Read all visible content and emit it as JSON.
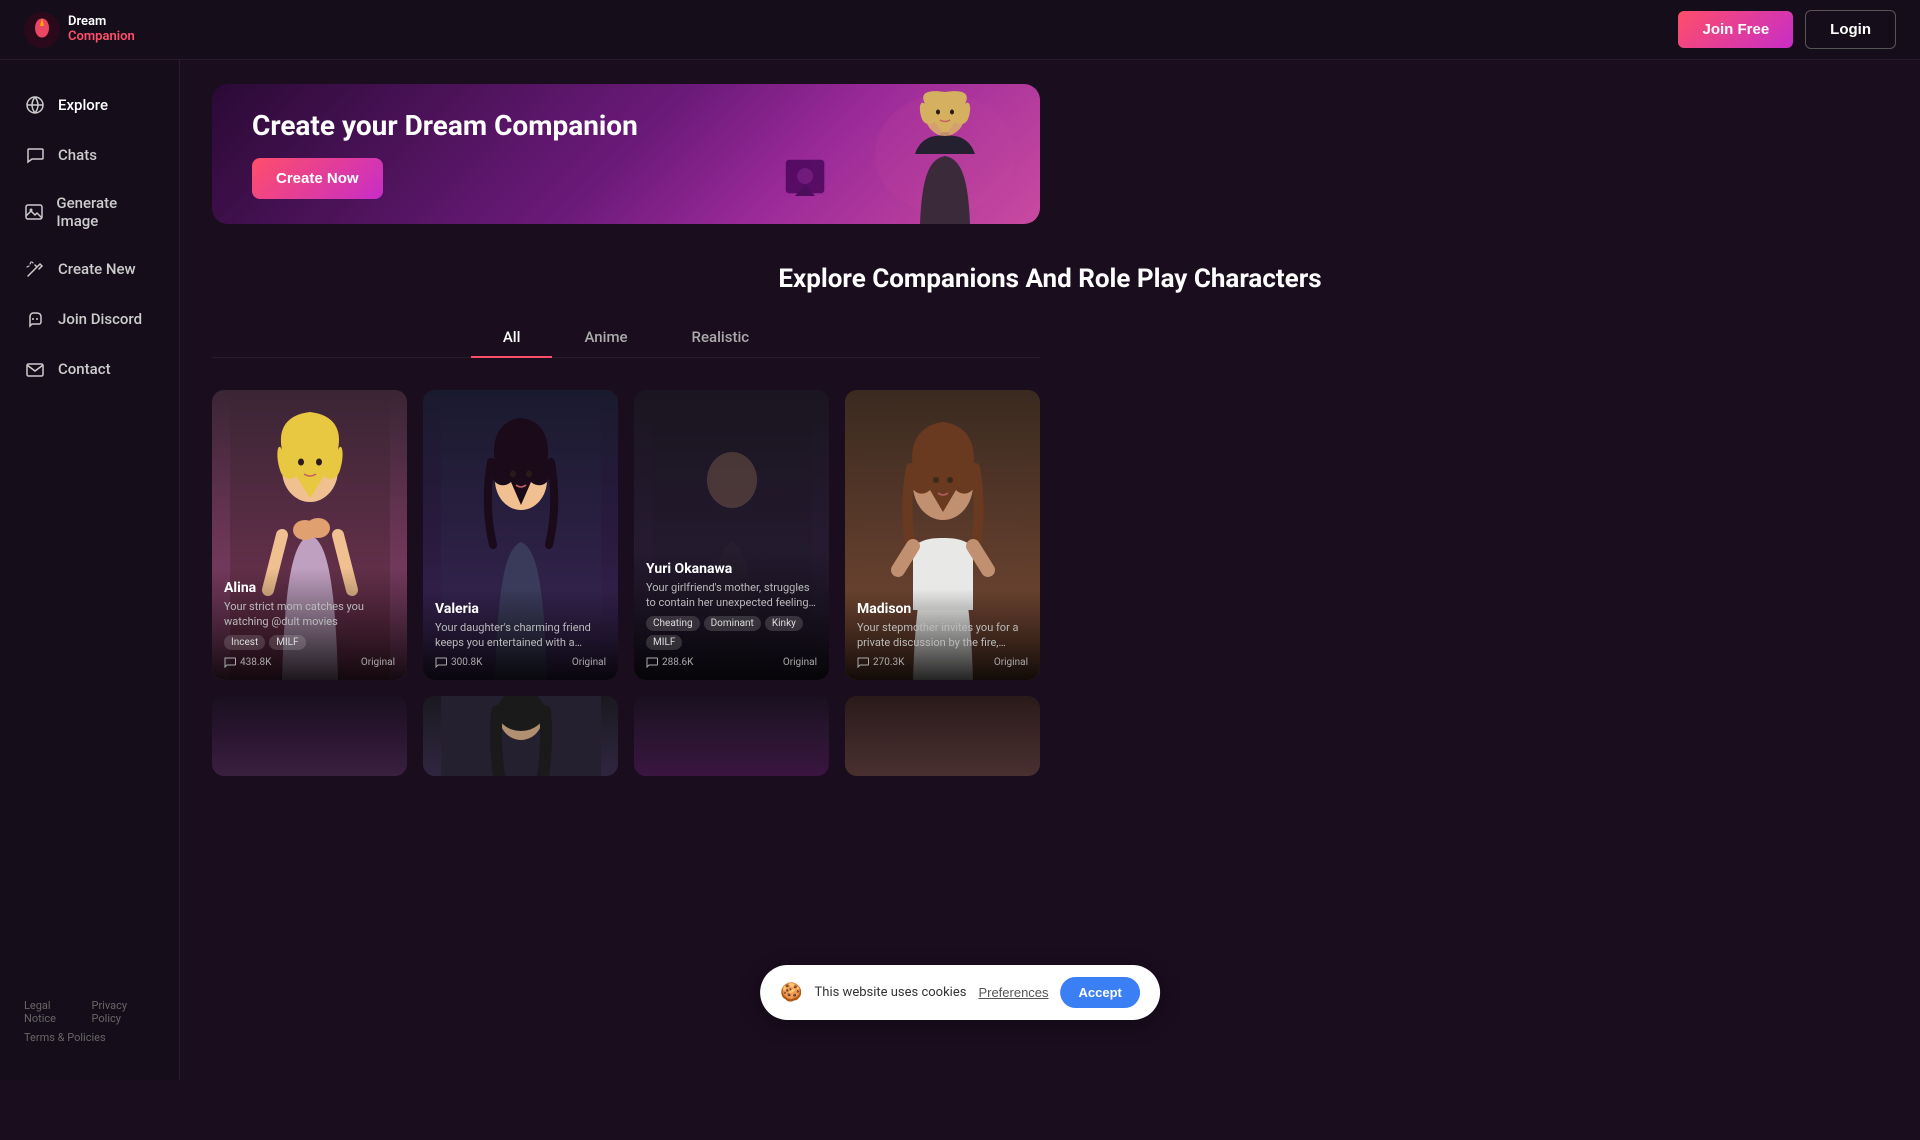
{
  "header": {
    "logo_dream": "Dream",
    "logo_companion": "Companion",
    "btn_join_free": "Join Free",
    "btn_login": "Login"
  },
  "sidebar": {
    "items": [
      {
        "id": "explore",
        "label": "Explore",
        "icon": "globe"
      },
      {
        "id": "chats",
        "label": "Chats",
        "icon": "chat"
      },
      {
        "id": "generate-image",
        "label": "Generate Image",
        "icon": "image"
      },
      {
        "id": "create-new",
        "label": "Create New",
        "icon": "wand"
      },
      {
        "id": "join-discord",
        "label": "Join Discord",
        "icon": "discord"
      },
      {
        "id": "contact",
        "label": "Contact",
        "icon": "mail"
      }
    ],
    "footer": {
      "links": [
        {
          "label": "Legal Notice"
        },
        {
          "label": "Privacy Policy"
        }
      ],
      "bottom": "Terms & Policies"
    }
  },
  "hero": {
    "title": "Create your Dream Companion",
    "btn_create": "Create Now"
  },
  "explore": {
    "section_title": "Explore Companions And Role Play Characters",
    "tabs": [
      {
        "id": "all",
        "label": "All",
        "active": true
      },
      {
        "id": "anime",
        "label": "Anime",
        "active": false
      },
      {
        "id": "realistic",
        "label": "Realistic",
        "active": false
      }
    ],
    "cards": [
      {
        "id": "alina",
        "name": "Alina",
        "description": "Your strict mom catches you watching @dult movies",
        "tags": [
          "Incest",
          "MILF"
        ],
        "count": "438.8K",
        "badge": "Original",
        "style": "alina"
      },
      {
        "id": "valeria",
        "name": "Valeria",
        "description": "Your daughter's charming friend keeps you entertained with a playful...",
        "tags": [],
        "count": "300.8K",
        "badge": "Original",
        "style": "valeria"
      },
      {
        "id": "yuri-okanawa",
        "name": "Yuri Okanawa",
        "description": "Your girlfriend's mother, struggles to contain her unexpected feelings of...",
        "tags": [
          "Cheating",
          "Dominant",
          "Kinky",
          "MILF"
        ],
        "count": "288.6K",
        "badge": "Original",
        "style": "yuri"
      },
      {
        "id": "madison",
        "name": "Madison",
        "description": "Your stepmother invites you for a private discussion by the fire, hinting a...",
        "tags": [],
        "count": "270.3K",
        "badge": "Original",
        "style": "madison"
      }
    ],
    "cards_row2": [
      {
        "id": "r2-1",
        "style": "row2-1"
      },
      {
        "id": "r2-2",
        "style": "row2-2"
      },
      {
        "id": "r2-3",
        "style": "row2-3"
      },
      {
        "id": "r2-4",
        "style": "row2-4"
      }
    ]
  },
  "cookie": {
    "message": "This website uses cookies",
    "preferences_label": "Preferences",
    "accept_label": "Accept"
  }
}
